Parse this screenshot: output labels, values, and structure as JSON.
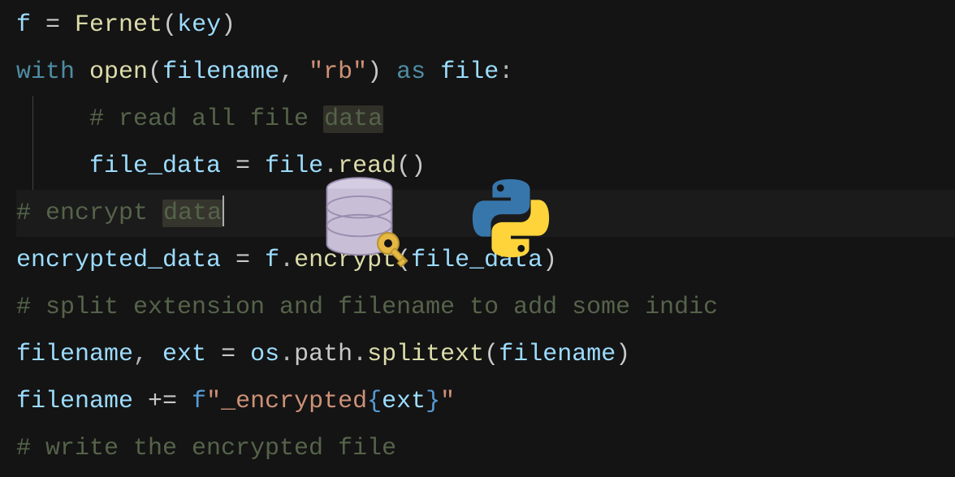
{
  "code": {
    "line1": {
      "var": "f",
      "assign": " = ",
      "func": "Fernet",
      "lparen": "(",
      "arg": "key",
      "rparen": ")"
    },
    "line2": {
      "keyword": "with",
      "space1": " ",
      "builtin": "open",
      "lparen": "(",
      "arg1": "filename",
      "comma": ", ",
      "string": "\"rb\"",
      "rparen": ")",
      "space2": " ",
      "as": "as",
      "space3": " ",
      "var": "file",
      "colon": ":"
    },
    "line3": {
      "indent": "     ",
      "comment_start": "# read all file ",
      "highlight": "data"
    },
    "line4": {
      "indent": "     ",
      "var1": "file_data",
      "assign": " = ",
      "var2": "file",
      "dot": ".",
      "method": "read",
      "parens": "()"
    },
    "line5": {
      "comment_start": "# encrypt ",
      "highlight": "data"
    },
    "line6": {
      "var1": "encrypted_data",
      "assign": " = ",
      "obj": "f",
      "dot": ".",
      "method": "encrypt",
      "lparen": "(",
      "arg": "file_data",
      "rparen": ")"
    },
    "line7": {
      "comment": "# split extension and filename to add some indic"
    },
    "line8": {
      "var1": "filename",
      "comma": ", ",
      "var2": "ext",
      "assign": " = ",
      "obj": "os",
      "dot1": ".",
      "prop": "path",
      "dot2": ".",
      "method": "splitext",
      "lparen": "(",
      "arg": "filename",
      "rparen": ")"
    },
    "line9": {
      "var": "filename",
      "op": " += ",
      "prefix": "f",
      "str1": "\"_encrypted",
      "lbrace": "{",
      "fvar": "ext",
      "rbrace": "}",
      "str2": "\""
    },
    "line10": {
      "comment": "# write the encrypted file"
    }
  },
  "icons": {
    "database": "database-icon",
    "key": "key-icon",
    "python": "python-icon"
  }
}
